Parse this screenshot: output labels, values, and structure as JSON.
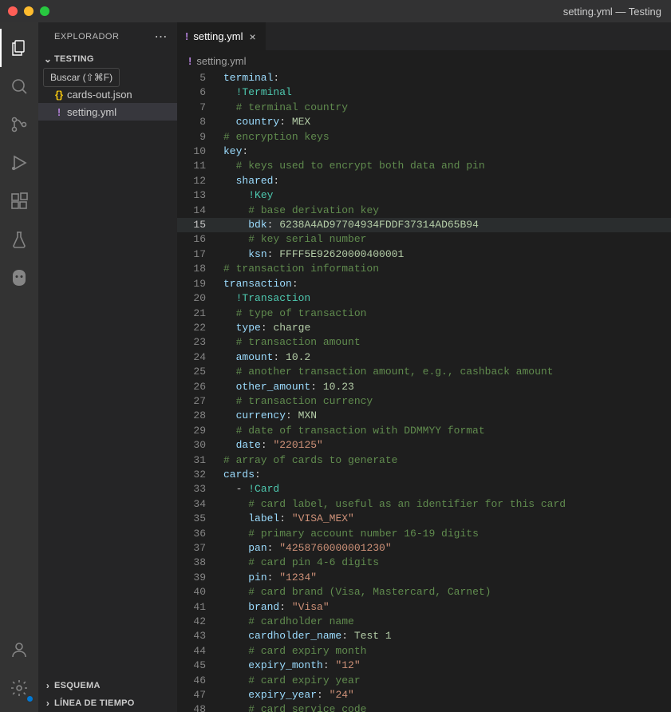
{
  "window": {
    "title": "setting.yml — Testing"
  },
  "sidebar": {
    "title": "EXPLORADOR",
    "tooltip": "Buscar (⇧⌘F)",
    "project": "TESTING",
    "files": [
      {
        "icon": "{}",
        "label": "cards-out.json",
        "iconClass": "json-icon"
      },
      {
        "icon": "!",
        "label": "setting.yml",
        "iconClass": "yml-icon"
      }
    ],
    "bottom": [
      {
        "label": "ESQUEMA"
      },
      {
        "label": "LÍNEA DE TIEMPO"
      }
    ]
  },
  "tab": {
    "icon": "!",
    "label": "setting.yml"
  },
  "breadcrumb": {
    "icon": "!",
    "label": "setting.yml"
  },
  "editor": {
    "startLine": 5,
    "currentLine": 15,
    "lines": [
      {
        "indent": 0,
        "tokens": [
          [
            "key",
            "terminal"
          ],
          [
            "punct",
            ":"
          ]
        ]
      },
      {
        "indent": 1,
        "tokens": [
          [
            "tag",
            "!Terminal"
          ]
        ]
      },
      {
        "indent": 1,
        "tokens": [
          [
            "comment",
            "# terminal country"
          ]
        ]
      },
      {
        "indent": 1,
        "tokens": [
          [
            "key",
            "country"
          ],
          [
            "punct",
            ": "
          ],
          [
            "value",
            "MEX"
          ]
        ]
      },
      {
        "indent": 0,
        "tokens": [
          [
            "comment",
            "# encryption keys"
          ]
        ]
      },
      {
        "indent": 0,
        "tokens": [
          [
            "key",
            "key"
          ],
          [
            "punct",
            ":"
          ]
        ]
      },
      {
        "indent": 1,
        "tokens": [
          [
            "comment",
            "# keys used to encrypt both data and pin"
          ]
        ]
      },
      {
        "indent": 1,
        "tokens": [
          [
            "key",
            "shared"
          ],
          [
            "punct",
            ":"
          ]
        ]
      },
      {
        "indent": 2,
        "tokens": [
          [
            "tag",
            "!Key"
          ]
        ]
      },
      {
        "indent": 2,
        "tokens": [
          [
            "comment",
            "# base derivation key"
          ]
        ]
      },
      {
        "indent": 2,
        "tokens": [
          [
            "key",
            "bdk"
          ],
          [
            "punct",
            ": "
          ],
          [
            "value",
            "6238A4AD97704934FDDF37314AD65B94"
          ]
        ]
      },
      {
        "indent": 2,
        "tokens": [
          [
            "comment",
            "# key serial number"
          ]
        ]
      },
      {
        "indent": 2,
        "tokens": [
          [
            "key",
            "ksn"
          ],
          [
            "punct",
            ": "
          ],
          [
            "value",
            "FFFF5E92620000400001"
          ]
        ]
      },
      {
        "indent": 0,
        "tokens": [
          [
            "comment",
            "# transaction information"
          ]
        ]
      },
      {
        "indent": 0,
        "tokens": [
          [
            "key",
            "transaction"
          ],
          [
            "punct",
            ":"
          ]
        ]
      },
      {
        "indent": 1,
        "tokens": [
          [
            "tag",
            "!Transaction"
          ]
        ]
      },
      {
        "indent": 1,
        "tokens": [
          [
            "comment",
            "# type of transaction"
          ]
        ]
      },
      {
        "indent": 1,
        "tokens": [
          [
            "key",
            "type"
          ],
          [
            "punct",
            ": "
          ],
          [
            "value",
            "charge"
          ]
        ]
      },
      {
        "indent": 1,
        "tokens": [
          [
            "comment",
            "# transaction amount"
          ]
        ]
      },
      {
        "indent": 1,
        "tokens": [
          [
            "key",
            "amount"
          ],
          [
            "punct",
            ": "
          ],
          [
            "value",
            "10.2"
          ]
        ]
      },
      {
        "indent": 1,
        "tokens": [
          [
            "comment",
            "# another transaction amount, e.g., cashback amount"
          ]
        ]
      },
      {
        "indent": 1,
        "tokens": [
          [
            "key",
            "other_amount"
          ],
          [
            "punct",
            ": "
          ],
          [
            "value",
            "10.23"
          ]
        ]
      },
      {
        "indent": 1,
        "tokens": [
          [
            "comment",
            "# transaction currency"
          ]
        ]
      },
      {
        "indent": 1,
        "tokens": [
          [
            "key",
            "currency"
          ],
          [
            "punct",
            ": "
          ],
          [
            "value",
            "MXN"
          ]
        ]
      },
      {
        "indent": 1,
        "tokens": [
          [
            "comment",
            "# date of transaction with DDMMYY format"
          ]
        ]
      },
      {
        "indent": 1,
        "tokens": [
          [
            "key",
            "date"
          ],
          [
            "punct",
            ": "
          ],
          [
            "string",
            "\"220125\""
          ]
        ]
      },
      {
        "indent": 0,
        "tokens": [
          [
            "comment",
            "# array of cards to generate"
          ]
        ]
      },
      {
        "indent": 0,
        "tokens": [
          [
            "key",
            "cards"
          ],
          [
            "punct",
            ":"
          ]
        ]
      },
      {
        "indent": 1,
        "tokens": [
          [
            "punct",
            "- "
          ],
          [
            "tag",
            "!Card"
          ]
        ]
      },
      {
        "indent": 2,
        "tokens": [
          [
            "comment",
            "# card label, useful as an identifier for this card"
          ]
        ]
      },
      {
        "indent": 2,
        "tokens": [
          [
            "key",
            "label"
          ],
          [
            "punct",
            ": "
          ],
          [
            "string",
            "\"VISA_MEX\""
          ]
        ]
      },
      {
        "indent": 2,
        "tokens": [
          [
            "comment",
            "# primary account number 16-19 digits"
          ]
        ]
      },
      {
        "indent": 2,
        "tokens": [
          [
            "key",
            "pan"
          ],
          [
            "punct",
            ": "
          ],
          [
            "string",
            "\"4258760000001230\""
          ]
        ]
      },
      {
        "indent": 2,
        "tokens": [
          [
            "comment",
            "# card pin 4-6 digits"
          ]
        ]
      },
      {
        "indent": 2,
        "tokens": [
          [
            "key",
            "pin"
          ],
          [
            "punct",
            ": "
          ],
          [
            "string",
            "\"1234\""
          ]
        ]
      },
      {
        "indent": 2,
        "tokens": [
          [
            "comment",
            "# card brand (Visa, Mastercard, Carnet)"
          ]
        ]
      },
      {
        "indent": 2,
        "tokens": [
          [
            "key",
            "brand"
          ],
          [
            "punct",
            ": "
          ],
          [
            "string",
            "\"Visa\""
          ]
        ]
      },
      {
        "indent": 2,
        "tokens": [
          [
            "comment",
            "# cardholder name"
          ]
        ]
      },
      {
        "indent": 2,
        "tokens": [
          [
            "key",
            "cardholder_name"
          ],
          [
            "punct",
            ": "
          ],
          [
            "value",
            "Test 1"
          ]
        ]
      },
      {
        "indent": 2,
        "tokens": [
          [
            "comment",
            "# card expiry month"
          ]
        ]
      },
      {
        "indent": 2,
        "tokens": [
          [
            "key",
            "expiry_month"
          ],
          [
            "punct",
            ": "
          ],
          [
            "string",
            "\"12\""
          ]
        ]
      },
      {
        "indent": 2,
        "tokens": [
          [
            "comment",
            "# card expiry year"
          ]
        ]
      },
      {
        "indent": 2,
        "tokens": [
          [
            "key",
            "expiry_year"
          ],
          [
            "punct",
            ": "
          ],
          [
            "string",
            "\"24\""
          ]
        ]
      },
      {
        "indent": 2,
        "tokens": [
          [
            "comment",
            "# card service code"
          ]
        ]
      }
    ]
  }
}
